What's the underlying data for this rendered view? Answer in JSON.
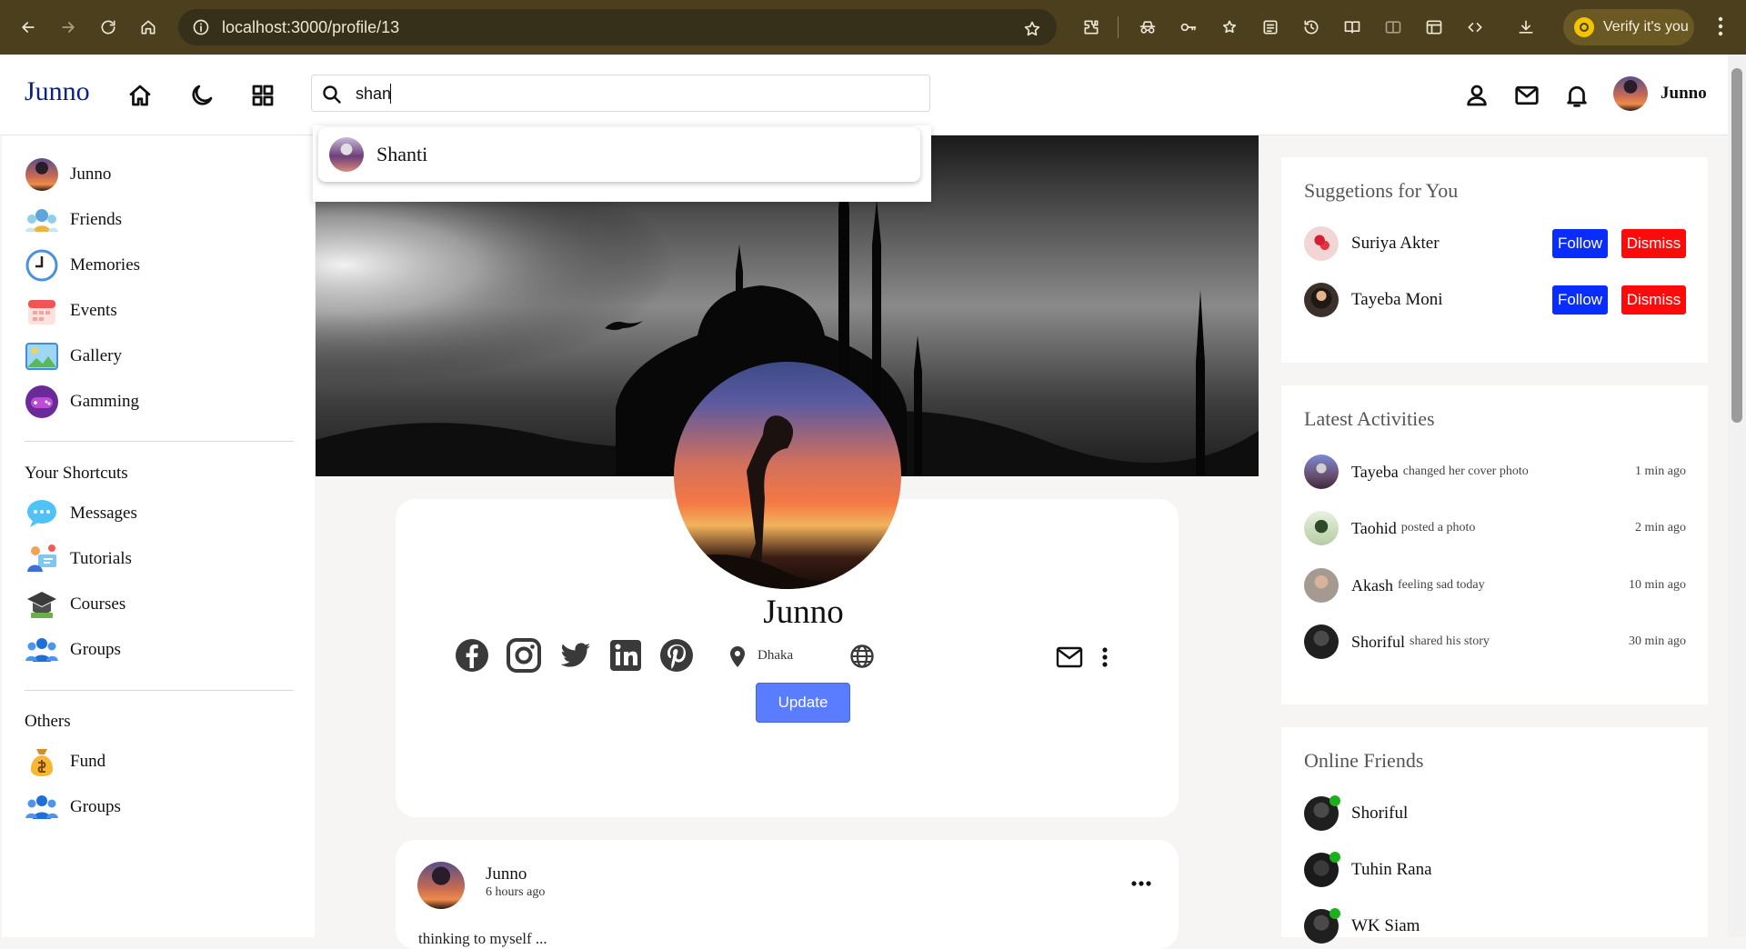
{
  "browser": {
    "url": "localhost:3000/profile/13",
    "verify_label": "Verify it's you"
  },
  "navbar": {
    "logo": "Junno",
    "search_value": "shan",
    "user_name": "Junno"
  },
  "search_results": [
    {
      "name": "Shanti"
    }
  ],
  "sidebar": {
    "items": [
      {
        "label": "Junno",
        "icon": "avatar"
      },
      {
        "label": "Friends",
        "icon": "friends-icon"
      },
      {
        "label": "Memories",
        "icon": "clock-icon"
      },
      {
        "label": "Events",
        "icon": "calendar-icon"
      },
      {
        "label": "Gallery",
        "icon": "gallery-icon"
      },
      {
        "label": "Gamming",
        "icon": "gamepad-icon"
      }
    ],
    "shortcuts_title": "Your Shortcuts",
    "shortcuts": [
      {
        "label": "Messages",
        "icon": "chat-icon"
      },
      {
        "label": "Tutorials",
        "icon": "tutorials-icon"
      },
      {
        "label": "Courses",
        "icon": "graduation-cap-icon"
      },
      {
        "label": "Groups",
        "icon": "group-icon"
      }
    ],
    "others_title": "Others",
    "others": [
      {
        "label": "Fund",
        "icon": "money-bag-icon"
      },
      {
        "label": "Groups",
        "icon": "group-icon"
      }
    ]
  },
  "profile": {
    "name": "Junno",
    "location": "Dhaka",
    "update_label": "Update"
  },
  "post": {
    "author": "Junno",
    "time": "6 hours ago",
    "text": "thinking to myself ..."
  },
  "suggestions": {
    "title": "Suggetions for You",
    "follow_label": "Follow",
    "dismiss_label": "Dismiss",
    "people": [
      {
        "name": "Suriya Akter"
      },
      {
        "name": "Tayeba Moni"
      }
    ]
  },
  "activities": {
    "title": "Latest Activities",
    "items": [
      {
        "name": "Tayeba",
        "action": "changed her cover photo",
        "time": "1 min ago"
      },
      {
        "name": "Taohid",
        "action": "posted a photo",
        "time": "2 min ago"
      },
      {
        "name": "Akash",
        "action": "feeling sad today",
        "time": "10 min ago"
      },
      {
        "name": "Shoriful",
        "action": "shared his story",
        "time": "30 min ago"
      }
    ]
  },
  "online_friends": {
    "title": "Online Friends",
    "items": [
      {
        "name": "Shoriful"
      },
      {
        "name": "Tuhin Rana"
      },
      {
        "name": "WK Siam"
      }
    ]
  },
  "colors": {
    "logo": "#0b1f8e",
    "follow": "#0a2dff",
    "dismiss": "#ff0a0a",
    "update": "#5a7cff",
    "online": "#1cb11c"
  }
}
